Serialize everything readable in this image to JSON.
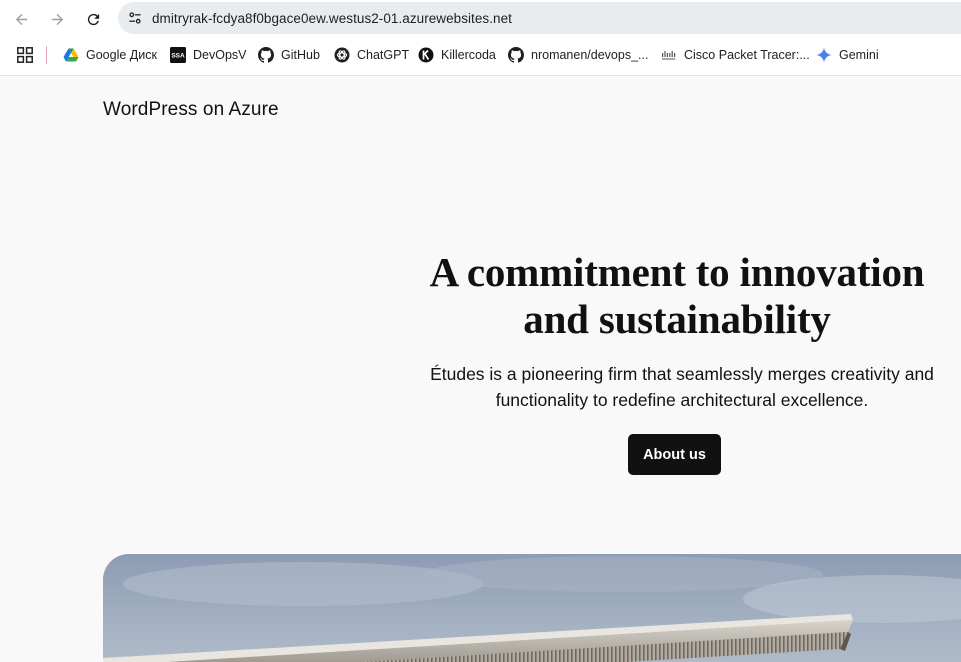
{
  "browser": {
    "url": "dmitryrak-fcdya8f0bgace0ew.westus2-01.azurewebsites.net",
    "bookmarks": [
      {
        "label": "Google Диск",
        "icon": "google-drive-icon"
      },
      {
        "label": "DevOpsV",
        "icon": "ssa-icon"
      },
      {
        "label": "GitHub",
        "icon": "github-icon"
      },
      {
        "label": "ChatGPT",
        "icon": "chatgpt-icon"
      },
      {
        "label": "Killercoda",
        "icon": "killercoda-icon"
      },
      {
        "label": "nromanen/devops_...",
        "icon": "github-icon"
      },
      {
        "label": "Cisco Packet Tracer:...",
        "icon": "cisco-icon"
      },
      {
        "label": "Gemini",
        "icon": "gemini-icon"
      }
    ],
    "ssa_icon_text": "SSA"
  },
  "site": {
    "title": "WordPress on Azure"
  },
  "hero": {
    "heading": "A commitment to innovation and sustainability",
    "text": "Études is a pioneering firm that seamlessly merges creativity and functionality to redefine architectural excellence.",
    "button_label": "About us"
  },
  "colors": {
    "page_bg": "#f9f9f9",
    "text": "#111111",
    "button_bg": "#111111",
    "button_text": "#ffffff",
    "omnibox_bg": "#e9ecef"
  }
}
